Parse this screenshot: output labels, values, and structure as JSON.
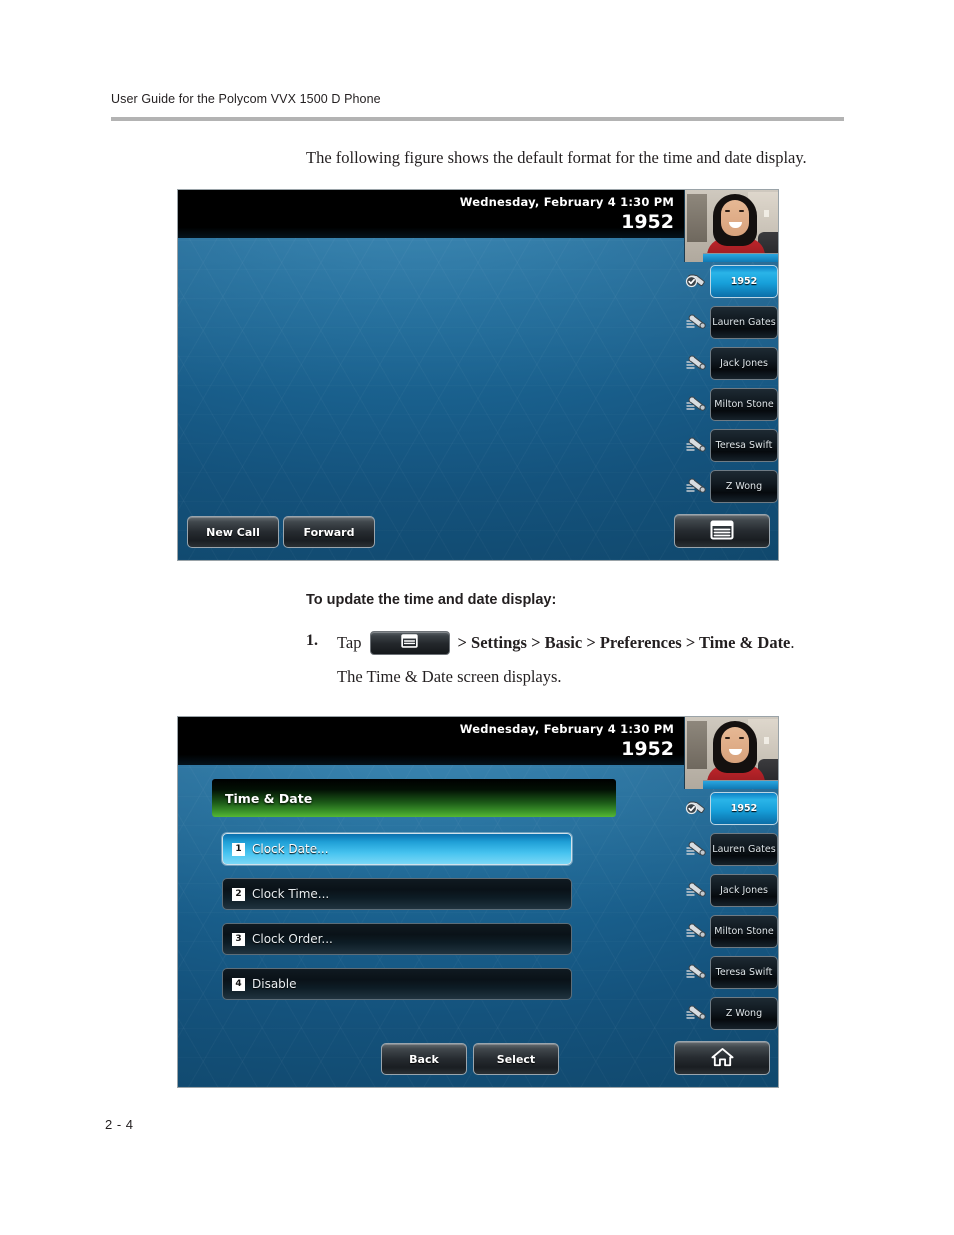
{
  "document": {
    "header": "User Guide for the Polycom VVX 1500 D Phone",
    "intro": "The following figure shows the default format for the time and date display.",
    "section_heading": "To update the time and date display:",
    "step_number": "1.",
    "step_tap_label": "Tap",
    "step_path": "> Settings > Basic > Preferences > Time & Date",
    "step_path_period": ".",
    "step_result": "The Time & Date screen displays.",
    "page_number": "2 - 4"
  },
  "icons": {
    "menu": "menu-icon",
    "home": "home-icon",
    "handset": "handset-icon",
    "handset_registered": "handset-registered-icon"
  },
  "colors": {
    "accent_blue": "#1f9fd6",
    "title_green": "#3f9a2c",
    "screen_bg": "#195f8c",
    "statusbar_bg": "#000000",
    "rule_gray": "#b3b3b3"
  },
  "phone_screen_1": {
    "status": {
      "datetime": "Wednesday, February 4  1:30 PM",
      "extension": "1952"
    },
    "avatar": "video-self-view",
    "line_keys": [
      {
        "label": "1952",
        "active": true,
        "registered": true
      },
      {
        "label": "Lauren Gates",
        "active": false,
        "registered": false
      },
      {
        "label": "Jack Jones",
        "active": false,
        "registered": false
      },
      {
        "label": "Milton Stone",
        "active": false,
        "registered": false
      },
      {
        "label": "Teresa Swift",
        "active": false,
        "registered": false
      },
      {
        "label": "Z Wong",
        "active": false,
        "registered": false
      }
    ],
    "softkeys": {
      "left": "New Call",
      "middle": "Forward",
      "right_icon": "menu-icon"
    }
  },
  "phone_screen_2": {
    "status": {
      "datetime": "Wednesday, February 4  1:30 PM",
      "extension": "1952"
    },
    "avatar": "video-self-view",
    "menu_title": "Time & Date",
    "menu_items": [
      {
        "index": "1",
        "label": "Clock Date...",
        "selected": true
      },
      {
        "index": "2",
        "label": "Clock Time...",
        "selected": false
      },
      {
        "index": "3",
        "label": "Clock Order...",
        "selected": false
      },
      {
        "index": "4",
        "label": "Disable",
        "selected": false
      }
    ],
    "line_keys": [
      {
        "label": "1952",
        "active": true,
        "registered": true
      },
      {
        "label": "Lauren Gates",
        "active": false,
        "registered": false
      },
      {
        "label": "Jack Jones",
        "active": false,
        "registered": false
      },
      {
        "label": "Milton Stone",
        "active": false,
        "registered": false
      },
      {
        "label": "Teresa Swift",
        "active": false,
        "registered": false
      },
      {
        "label": "Z Wong",
        "active": false,
        "registered": false
      }
    ],
    "softkeys": {
      "left": "Back",
      "middle": "Select",
      "right_icon": "home-icon"
    }
  }
}
